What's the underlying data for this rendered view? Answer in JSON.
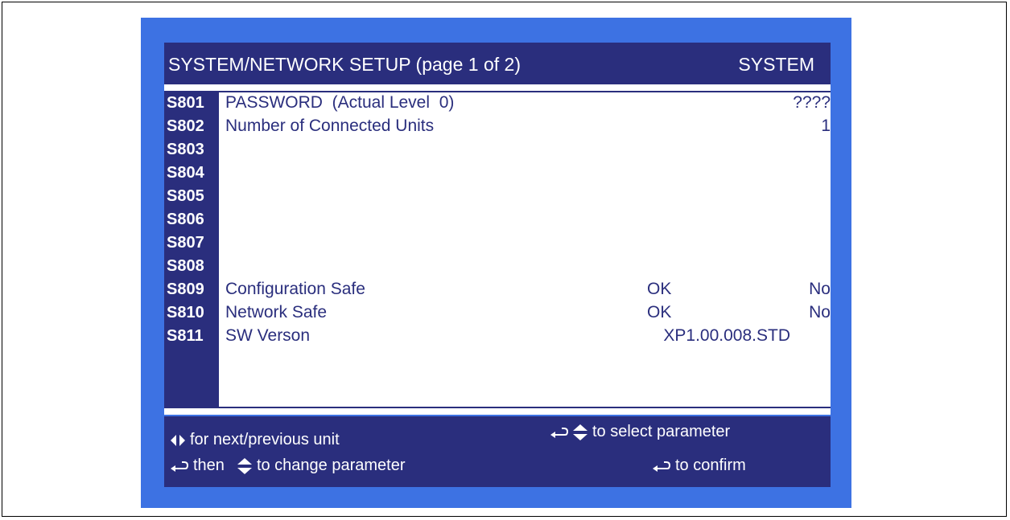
{
  "header": {
    "title": "SYSTEM/NETWORK SETUP (page 1 of 2)",
    "mode": "SYSTEM"
  },
  "rows": [
    {
      "code": "S801",
      "label": "PASSWORD  (Actual Level  0)",
      "status": "",
      "value": "????"
    },
    {
      "code": "S802",
      "label": "Number of Connected Units",
      "status": "",
      "value": "1"
    },
    {
      "code": "S803",
      "label": "",
      "status": "",
      "value": ""
    },
    {
      "code": "S804",
      "label": "",
      "status": "",
      "value": ""
    },
    {
      "code": "S805",
      "label": "",
      "status": "",
      "value": ""
    },
    {
      "code": "S806",
      "label": "",
      "status": "",
      "value": ""
    },
    {
      "code": "S807",
      "label": "",
      "status": "",
      "value": ""
    },
    {
      "code": "S808",
      "label": "",
      "status": "",
      "value": ""
    },
    {
      "code": "S809",
      "label": "Configuration Safe",
      "status": "OK",
      "value": "No"
    },
    {
      "code": "S810",
      "label": "Network Safe",
      "status": "OK",
      "value": "No"
    },
    {
      "code": "S811",
      "label": "SW Verson",
      "status": "",
      "value": "XP1.00.008.STD"
    }
  ],
  "footer": {
    "next_prev": "for next/previous unit",
    "then": "then",
    "change": "to change parameter",
    "select": "to select parameter",
    "confirm": "to confirm"
  },
  "icons": {
    "left_right": "left-right-arrows-icon",
    "up_down": "up-down-arrows-icon",
    "enter": "enter-return-icon"
  },
  "colors": {
    "frame_blue": "#3d72e3",
    "navy": "#2a2e7d",
    "panel": "#ffffff"
  }
}
